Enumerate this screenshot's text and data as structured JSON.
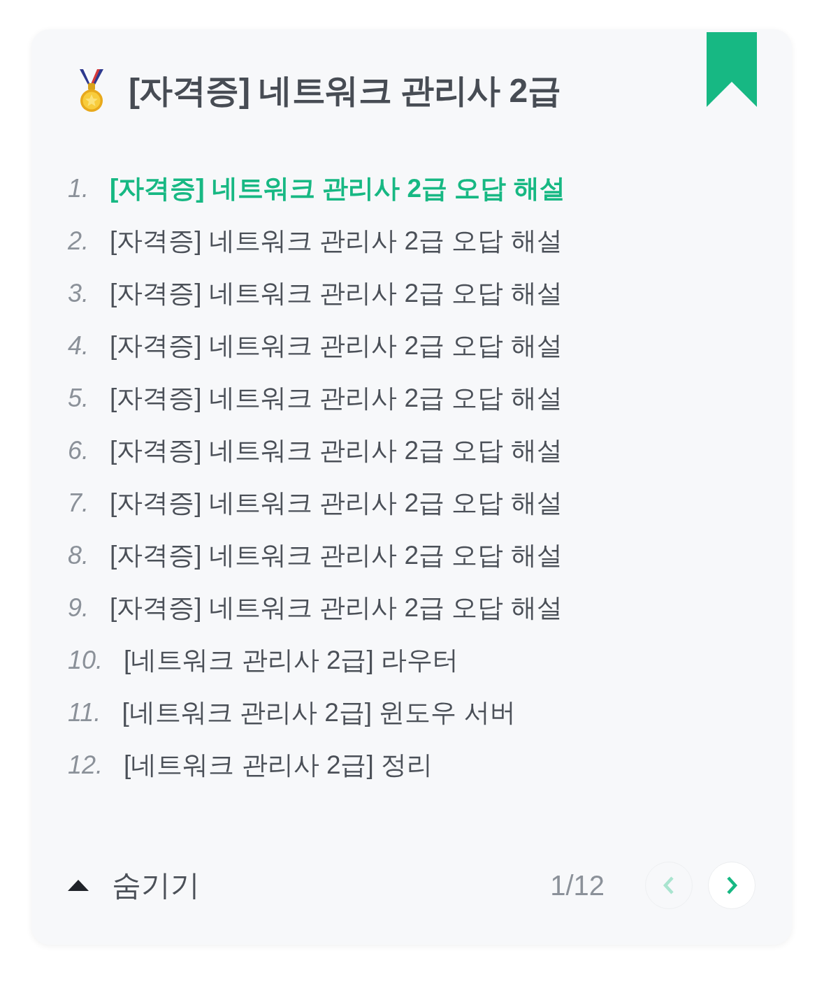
{
  "title": {
    "text": "[자격증] 네트워크 관리사 2급"
  },
  "items": [
    {
      "number": "1.",
      "text": "[자격증] 네트워크 관리사 2급 오답 해설",
      "selected": true
    },
    {
      "number": "2.",
      "text": "[자격증] 네트워크 관리사 2급 오답 해설",
      "selected": false
    },
    {
      "number": "3.",
      "text": "[자격증] 네트워크 관리사 2급 오답 해설",
      "selected": false
    },
    {
      "number": "4.",
      "text": "[자격증] 네트워크 관리사 2급 오답 해설",
      "selected": false
    },
    {
      "number": "5.",
      "text": "[자격증] 네트워크 관리사 2급 오답 해설",
      "selected": false
    },
    {
      "number": "6.",
      "text": "[자격증] 네트워크 관리사 2급 오답 해설",
      "selected": false
    },
    {
      "number": "7.",
      "text": "[자격증] 네트워크 관리사 2급 오답 해설",
      "selected": false
    },
    {
      "number": "8.",
      "text": "[자격증] 네트워크 관리사 2급 오답 해설",
      "selected": false
    },
    {
      "number": "9.",
      "text": "[자격증] 네트워크 관리사 2급 오답 해설",
      "selected": false
    },
    {
      "number": "10.",
      "text": "[네트워크 관리사 2급] 라우터",
      "selected": false
    },
    {
      "number": "11.",
      "text": "[네트워크 관리사 2급] 윈도우 서버",
      "selected": false
    },
    {
      "number": "12.",
      "text": "[네트워크 관리사 2급] 정리",
      "selected": false
    }
  ],
  "footer": {
    "toggle_label": "숨기기",
    "page_indicator": "1/12",
    "prev_button": {
      "disabled": true
    },
    "next_button": {
      "disabled": false
    }
  }
}
